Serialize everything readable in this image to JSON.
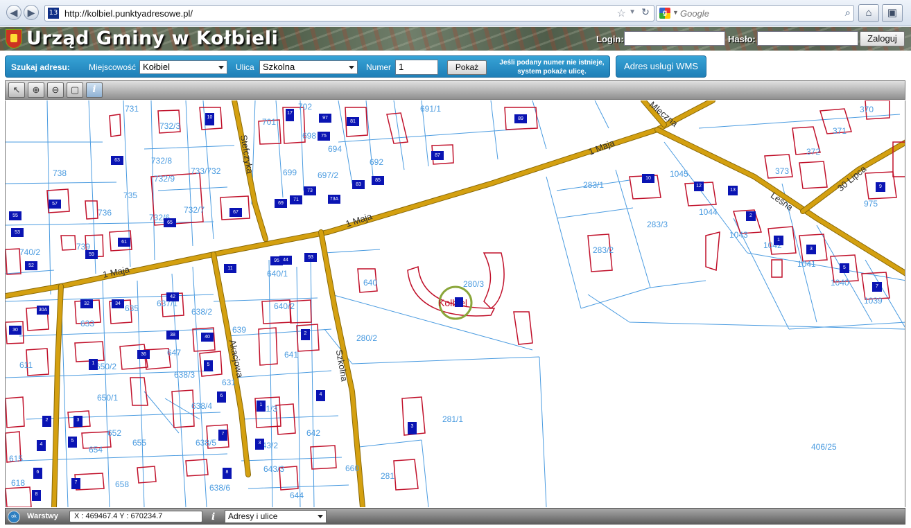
{
  "browser": {
    "tab_badge": "13",
    "url": "http://kolbiel.punktyadresowe.pl/",
    "search_placeholder": "Google",
    "star_icon": "bookmark-star-icon",
    "reload_icon": "reload-icon",
    "home_icon": "home-icon",
    "addon_icon": "addon-icon"
  },
  "header": {
    "title": "Urząd Gminy w Kołbieli",
    "login_label": "Login:",
    "password_label": "Hasło:",
    "login_button": "Zaloguj"
  },
  "search": {
    "heading": "Szukaj adresu:",
    "town_label": "Miejscowość",
    "town_value": "Kołbiel",
    "street_label": "Ulica",
    "street_value": "Szkolna",
    "number_label": "Numer",
    "number_value": "1",
    "show_button": "Pokaż",
    "hint": "Jeśli podany numer nie istnieje, system pokaże ulicę.",
    "wms_button": "Adres usługi WMS"
  },
  "map": {
    "tools": [
      "select-arrow-icon",
      "zoom-in-icon",
      "zoom-out-icon",
      "zoom-extent-icon",
      "info-icon"
    ],
    "colors": {
      "road": "#d4a010",
      "parcel_line": "#4a9be0",
      "building": "#c0102a",
      "address_point": "#0a14b3",
      "highlight": "#8aa63a"
    },
    "street_labels": [
      "1 Maja",
      "1 Maja",
      "1 Maja",
      "Szkolna",
      "Akacjowa",
      "Stefczyka",
      "Leśna",
      "30 Lipca",
      "Mleczna"
    ],
    "parcel_labels": [
      "731",
      "732/3",
      "701",
      "702",
      "691/1",
      "698",
      "694",
      "692",
      "697/2",
      "699",
      "733/732",
      "732/8",
      "732/9",
      "738",
      "736",
      "735",
      "732/7",
      "732/6",
      "740/2",
      "739",
      "640/1",
      "640/2",
      "637/1",
      "638/2",
      "633",
      "635",
      "639",
      "641",
      "647",
      "650/2",
      "638/3",
      "650/1",
      "638/4",
      "611",
      "652",
      "655",
      "638/5",
      "643/2",
      "642",
      "643/3",
      "654",
      "658",
      "638/6",
      "644",
      "615",
      "618",
      "283/1",
      "283/3",
      "283/2",
      "280/3",
      "280/2",
      "281/1",
      "406/25",
      "1045",
      "1044",
      "1043",
      "1042",
      "1041",
      "1040",
      "1039",
      "975",
      "373",
      "372",
      "371",
      "370",
      "281",
      "640",
      "631",
      "660",
      "281/3"
    ],
    "place_label": "Kołbiel",
    "building_numbers": [
      "3",
      "63",
      "57",
      "65",
      "61",
      "59",
      "55",
      "53",
      "52",
      "10",
      "17",
      "75",
      "81",
      "87",
      "89",
      "97",
      "69",
      "71",
      "73",
      "73A",
      "83",
      "85",
      "67",
      "95",
      "93",
      "11",
      "30A",
      "32",
      "34",
      "36",
      "38",
      "40",
      "42",
      "44",
      "30",
      "1",
      "2",
      "4",
      "3",
      "5",
      "6",
      "7",
      "8",
      "1",
      "2",
      "3",
      "4",
      "5",
      "6",
      "7",
      "8",
      "10",
      "12",
      "13",
      "2",
      "1",
      "3",
      "5",
      "7",
      "9"
    ]
  },
  "status": {
    "layers_icon": "ok",
    "layers_label": "Warstwy",
    "coords": "X : 469467.4  Y : 670234.7",
    "layer_value": "Adresy i ulice"
  }
}
